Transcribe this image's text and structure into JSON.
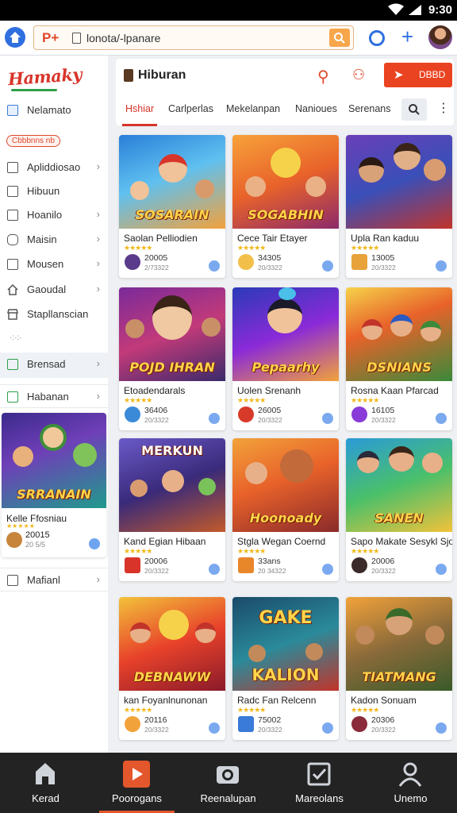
{
  "status": {
    "time": "9:30"
  },
  "browser": {
    "url_prefix": "P+",
    "url": "lonota/-lpanare"
  },
  "sidebar": {
    "logo": "Hamaky",
    "badge": "Cbbbnns nb",
    "items": [
      {
        "label": "Nelamato",
        "chevron": ""
      },
      {
        "label": "Apliddiosao",
        "chevron": "›"
      },
      {
        "label": "Hibuun",
        "chevron": ""
      },
      {
        "label": "Hoanilo",
        "chevron": "›"
      },
      {
        "label": "Maisin",
        "chevron": "›"
      },
      {
        "label": "Mousen",
        "chevron": "›"
      },
      {
        "label": "Gaoudal",
        "chevron": "›"
      },
      {
        "label": "Stapllanscian",
        "chevron": ""
      },
      {
        "label": "Brensad",
        "chevron": "›"
      },
      {
        "label": "Habanan",
        "chevron": "›"
      },
      {
        "label": "Mafianl",
        "chevron": "›"
      }
    ],
    "featured": {
      "overlay": "SRRANAIN",
      "title": "Kelle Ffosniau",
      "rating": "★★★★★",
      "count": "20015",
      "sub": "20 5/5"
    }
  },
  "header": {
    "title": "Hiburan",
    "action_label": "DBBD",
    "tabs": [
      "Hshiar",
      "Carlperlas",
      "Mekelanpan",
      "Nanioues",
      "Serenans"
    ]
  },
  "games": [
    {
      "title": "Saolan Pelliodien",
      "overlay": "SOSARAIN",
      "stars": "★★★★★",
      "count": "20005",
      "sub": "2/73322"
    },
    {
      "title": "Cece Tair Etayer",
      "overlay": "SOGABHIN",
      "stars": "★★★★★",
      "count": "34305",
      "sub": "20/3322"
    },
    {
      "title": "Upla Ran kaduu",
      "overlay": "",
      "stars": "★★★★★",
      "count": "13005",
      "sub": "20/3322"
    },
    {
      "title": "Etoadendarals",
      "overlay": "POJD IHRAN",
      "stars": "★★★★★",
      "count": "36406",
      "sub": "20/3322"
    },
    {
      "title": "Uolen Srenanh",
      "overlay": "Pepaarhy",
      "stars": "★★★★★",
      "count": "26005",
      "sub": "20/3322"
    },
    {
      "title": "Rosna Kaan Pfarcad",
      "overlay": "DSNIANS",
      "stars": "★★★★★",
      "count": "16105",
      "sub": "20/3322"
    },
    {
      "title": "Kand Egian Hibaan",
      "overlay": "MERKUN",
      "stars": "★★★★★",
      "count": "20006",
      "sub": "20/3322"
    },
    {
      "title": "Stgla Wegan Coernd",
      "overlay": "Hoonoady",
      "stars": "★★★★★",
      "count": "33ans",
      "sub": "20 34322"
    },
    {
      "title": "Sapo Makate Sesykl Sjo",
      "overlay": "SANEN",
      "stars": "★★★★★",
      "count": "20006",
      "sub": "20/3322"
    },
    {
      "title": "kan Foyanlnunonan",
      "overlay": "DEBNAWW",
      "stars": "★★★★★",
      "count": "20116",
      "sub": "20/3322"
    },
    {
      "title": "Radc Fan Relcenn",
      "overlay": "KALION",
      "stars": "★★★★★",
      "count": "75002",
      "sub": "20/3322"
    },
    {
      "title": "Kadon Sonuam",
      "overlay": "TIATMANG",
      "stars": "★★★★★",
      "count": "20306",
      "sub": "20/3322"
    }
  ],
  "bottom_nav": [
    {
      "label": "Kerad",
      "active": false
    },
    {
      "label": "Poorogans",
      "active": true
    },
    {
      "label": "Reenalupan",
      "active": false
    },
    {
      "label": "Mareolans",
      "active": false
    },
    {
      "label": "Unemo",
      "active": false
    }
  ]
}
